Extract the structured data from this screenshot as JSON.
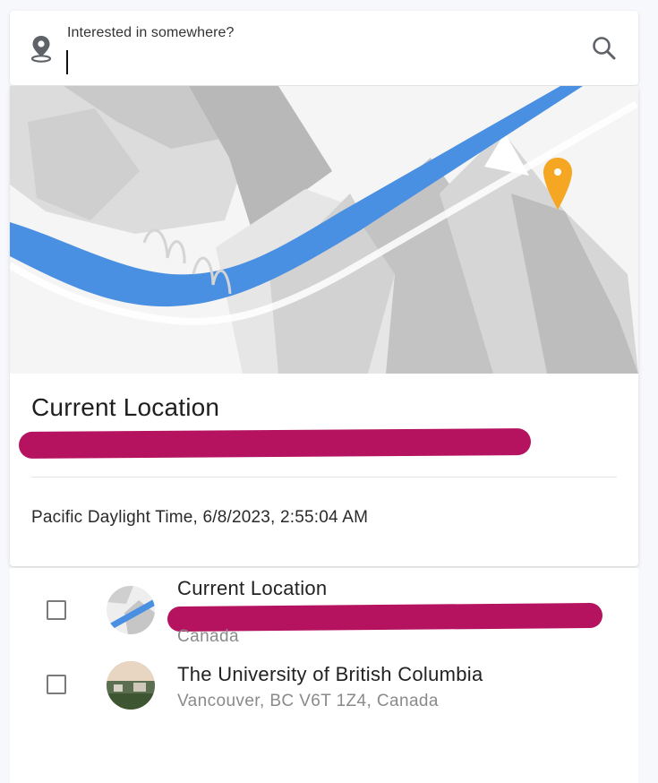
{
  "search": {
    "label": "Interested in somewhere?",
    "value": "",
    "placeholder": "",
    "icons": {
      "left": "location-pin-icon",
      "right": "search-icon"
    }
  },
  "location_card": {
    "title": "Current Location",
    "timestamp": "Pacific Daylight Time, 6/8/2023, 2:55:04 AM",
    "map_marker_color": "#f5a623",
    "river_color": "#4a90e2"
  },
  "results": [
    {
      "title": "Current Location",
      "subtitle": "Canada",
      "checked": false
    },
    {
      "title": "The University of British Columbia",
      "subtitle": "Vancouver, BC V6T 1Z4, Canada",
      "checked": false
    }
  ],
  "colors": {
    "redaction": "#b5135f",
    "background": "#f7f8fb"
  }
}
